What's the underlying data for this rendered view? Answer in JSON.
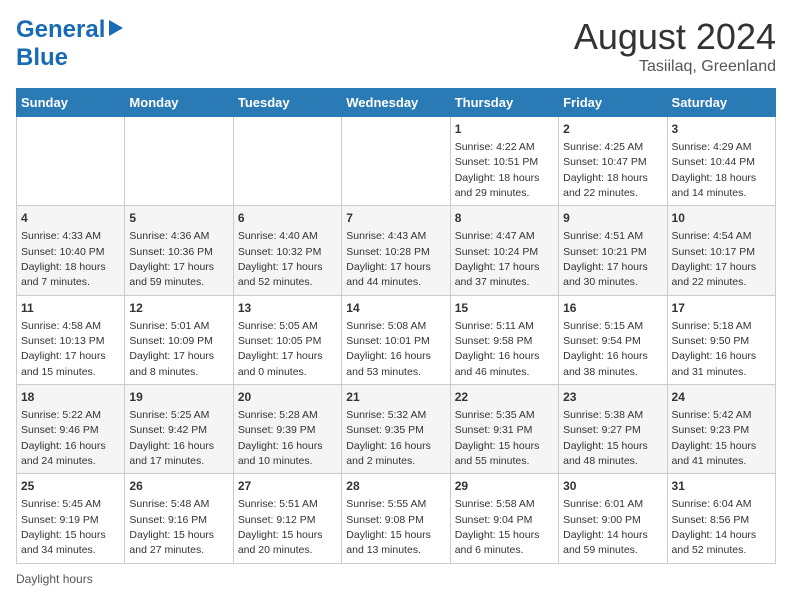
{
  "header": {
    "logo_line1": "General",
    "logo_line2": "Blue",
    "month_title": "August 2024",
    "subtitle": "Tasiilaq, Greenland"
  },
  "days_of_week": [
    "Sunday",
    "Monday",
    "Tuesday",
    "Wednesday",
    "Thursday",
    "Friday",
    "Saturday"
  ],
  "weeks": [
    [
      {
        "day": "",
        "info": ""
      },
      {
        "day": "",
        "info": ""
      },
      {
        "day": "",
        "info": ""
      },
      {
        "day": "",
        "info": ""
      },
      {
        "day": "1",
        "info": "Sunrise: 4:22 AM\nSunset: 10:51 PM\nDaylight: 18 hours and 29 minutes."
      },
      {
        "day": "2",
        "info": "Sunrise: 4:25 AM\nSunset: 10:47 PM\nDaylight: 18 hours and 22 minutes."
      },
      {
        "day": "3",
        "info": "Sunrise: 4:29 AM\nSunset: 10:44 PM\nDaylight: 18 hours and 14 minutes."
      }
    ],
    [
      {
        "day": "4",
        "info": "Sunrise: 4:33 AM\nSunset: 10:40 PM\nDaylight: 18 hours and 7 minutes."
      },
      {
        "day": "5",
        "info": "Sunrise: 4:36 AM\nSunset: 10:36 PM\nDaylight: 17 hours and 59 minutes."
      },
      {
        "day": "6",
        "info": "Sunrise: 4:40 AM\nSunset: 10:32 PM\nDaylight: 17 hours and 52 minutes."
      },
      {
        "day": "7",
        "info": "Sunrise: 4:43 AM\nSunset: 10:28 PM\nDaylight: 17 hours and 44 minutes."
      },
      {
        "day": "8",
        "info": "Sunrise: 4:47 AM\nSunset: 10:24 PM\nDaylight: 17 hours and 37 minutes."
      },
      {
        "day": "9",
        "info": "Sunrise: 4:51 AM\nSunset: 10:21 PM\nDaylight: 17 hours and 30 minutes."
      },
      {
        "day": "10",
        "info": "Sunrise: 4:54 AM\nSunset: 10:17 PM\nDaylight: 17 hours and 22 minutes."
      }
    ],
    [
      {
        "day": "11",
        "info": "Sunrise: 4:58 AM\nSunset: 10:13 PM\nDaylight: 17 hours and 15 minutes."
      },
      {
        "day": "12",
        "info": "Sunrise: 5:01 AM\nSunset: 10:09 PM\nDaylight: 17 hours and 8 minutes."
      },
      {
        "day": "13",
        "info": "Sunrise: 5:05 AM\nSunset: 10:05 PM\nDaylight: 17 hours and 0 minutes."
      },
      {
        "day": "14",
        "info": "Sunrise: 5:08 AM\nSunset: 10:01 PM\nDaylight: 16 hours and 53 minutes."
      },
      {
        "day": "15",
        "info": "Sunrise: 5:11 AM\nSunset: 9:58 PM\nDaylight: 16 hours and 46 minutes."
      },
      {
        "day": "16",
        "info": "Sunrise: 5:15 AM\nSunset: 9:54 PM\nDaylight: 16 hours and 38 minutes."
      },
      {
        "day": "17",
        "info": "Sunrise: 5:18 AM\nSunset: 9:50 PM\nDaylight: 16 hours and 31 minutes."
      }
    ],
    [
      {
        "day": "18",
        "info": "Sunrise: 5:22 AM\nSunset: 9:46 PM\nDaylight: 16 hours and 24 minutes."
      },
      {
        "day": "19",
        "info": "Sunrise: 5:25 AM\nSunset: 9:42 PM\nDaylight: 16 hours and 17 minutes."
      },
      {
        "day": "20",
        "info": "Sunrise: 5:28 AM\nSunset: 9:39 PM\nDaylight: 16 hours and 10 minutes."
      },
      {
        "day": "21",
        "info": "Sunrise: 5:32 AM\nSunset: 9:35 PM\nDaylight: 16 hours and 2 minutes."
      },
      {
        "day": "22",
        "info": "Sunrise: 5:35 AM\nSunset: 9:31 PM\nDaylight: 15 hours and 55 minutes."
      },
      {
        "day": "23",
        "info": "Sunrise: 5:38 AM\nSunset: 9:27 PM\nDaylight: 15 hours and 48 minutes."
      },
      {
        "day": "24",
        "info": "Sunrise: 5:42 AM\nSunset: 9:23 PM\nDaylight: 15 hours and 41 minutes."
      }
    ],
    [
      {
        "day": "25",
        "info": "Sunrise: 5:45 AM\nSunset: 9:19 PM\nDaylight: 15 hours and 34 minutes."
      },
      {
        "day": "26",
        "info": "Sunrise: 5:48 AM\nSunset: 9:16 PM\nDaylight: 15 hours and 27 minutes."
      },
      {
        "day": "27",
        "info": "Sunrise: 5:51 AM\nSunset: 9:12 PM\nDaylight: 15 hours and 20 minutes."
      },
      {
        "day": "28",
        "info": "Sunrise: 5:55 AM\nSunset: 9:08 PM\nDaylight: 15 hours and 13 minutes."
      },
      {
        "day": "29",
        "info": "Sunrise: 5:58 AM\nSunset: 9:04 PM\nDaylight: 15 hours and 6 minutes."
      },
      {
        "day": "30",
        "info": "Sunrise: 6:01 AM\nSunset: 9:00 PM\nDaylight: 14 hours and 59 minutes."
      },
      {
        "day": "31",
        "info": "Sunrise: 6:04 AM\nSunset: 8:56 PM\nDaylight: 14 hours and 52 minutes."
      }
    ]
  ],
  "footer": {
    "daylight_label": "Daylight hours"
  }
}
